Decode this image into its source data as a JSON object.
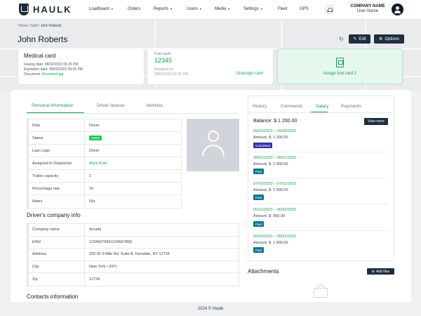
{
  "brand": {
    "name": "HAULK"
  },
  "nav": {
    "items": [
      {
        "label": "Loadboard",
        "dropdown": true
      },
      {
        "label": "Orders",
        "dropdown": false
      },
      {
        "label": "Reports",
        "dropdown": true
      },
      {
        "label": "Users",
        "dropdown": true
      },
      {
        "label": "Media",
        "dropdown": true
      },
      {
        "label": "Settings",
        "dropdown": true
      },
      {
        "label": "Fleet",
        "dropdown": false
      },
      {
        "label": "GPS",
        "dropdown": false
      }
    ],
    "company_name": "COMPANY NAME",
    "user_name": "User Name"
  },
  "breadcrumb": {
    "home": "Home",
    "staff": "Staff",
    "current": "John Roberts"
  },
  "page": {
    "title": "John Roberts",
    "edit_label": "Edit",
    "options_label": "Options"
  },
  "medical_card": {
    "title": "Medical card",
    "issuing_date": "Issuing date: 08/02/2022 06:35 PM",
    "expiration_date": "Expiration date: 08/02/2022 06:35 PM",
    "document_label": "Document:",
    "document_link": "Document.jpg"
  },
  "fuel_card": {
    "label": "Fuel card#",
    "number": "12345",
    "assigned_label": "Assigned on",
    "assigned_date": "08/02/2022 06:35 PM",
    "unassign_label": "Unassign card"
  },
  "assign_card": {
    "label": "Assign fuel card 2"
  },
  "left_tabs": [
    "Personal information",
    "Driver license",
    "Vehicles"
  ],
  "personal_info": [
    {
      "key": "Role",
      "value": "Driver"
    },
    {
      "key": "Status",
      "value": "Active"
    },
    {
      "key": "Last Login",
      "value": "Driver"
    },
    {
      "key": "Assigned to Dispatcher",
      "value": "Mark Rost"
    },
    {
      "key": "Trailer capacity",
      "value": "1"
    },
    {
      "key": "Percentage rate",
      "value": "10"
    },
    {
      "key": "Notes",
      "value": "N/a"
    }
  ],
  "company_info": {
    "title": "Driver's company info",
    "rows": [
      {
        "key": "Company name",
        "value": "Arcade"
      },
      {
        "key": "EIN#",
        "value": "12345678901234567890"
      },
      {
        "key": "Address",
        "value": "320 W. 9 Mile Rd. Suite B, Ferndale, NY 12734"
      },
      {
        "key": "City",
        "value": "New York • (NY)"
      },
      {
        "key": "Zip",
        "value": "12734"
      }
    ]
  },
  "contacts": {
    "title": "Contacts information"
  },
  "right_tabs": [
    "History",
    "Comments",
    "Salary",
    "Payments"
  ],
  "salary": {
    "balance": "Balance: $ 1 200.00",
    "view_more_label": "View more",
    "entries": [
      {
        "period": "09/01/2023 – 09/30/2023",
        "amount": "Amount, $: 1 200.00",
        "status": "Calculated",
        "status_color": "#3730a3"
      },
      {
        "period": "08/01/2023 – 08/31/2023",
        "amount": "Amount, $: 2 400.00",
        "status": "Paid",
        "status_color": "#0e7490"
      },
      {
        "period": "07/01/2023 – 07/31/2023",
        "amount": "Amount, $: 1 500.00",
        "status": "Paid",
        "status_color": "#0e7490"
      },
      {
        "period": "06/01/2023 – 06/30/2023",
        "amount": "Amount, $: 900.00",
        "status": "Paid",
        "status_color": "#0e7490"
      },
      {
        "period": "05/01/2023 – 05/31/2023",
        "amount": "Amount, $: 1 000.00",
        "status": "Paid",
        "status_color": "#0e7490"
      }
    ]
  },
  "attachments": {
    "title": "Attachments",
    "add_label": "Add files"
  },
  "footer": {
    "text": "2024 © Haulk"
  },
  "colors": {
    "accent": "#16a34a",
    "dark_button": "#1f2d3d",
    "active_badge": "#22c55e"
  }
}
